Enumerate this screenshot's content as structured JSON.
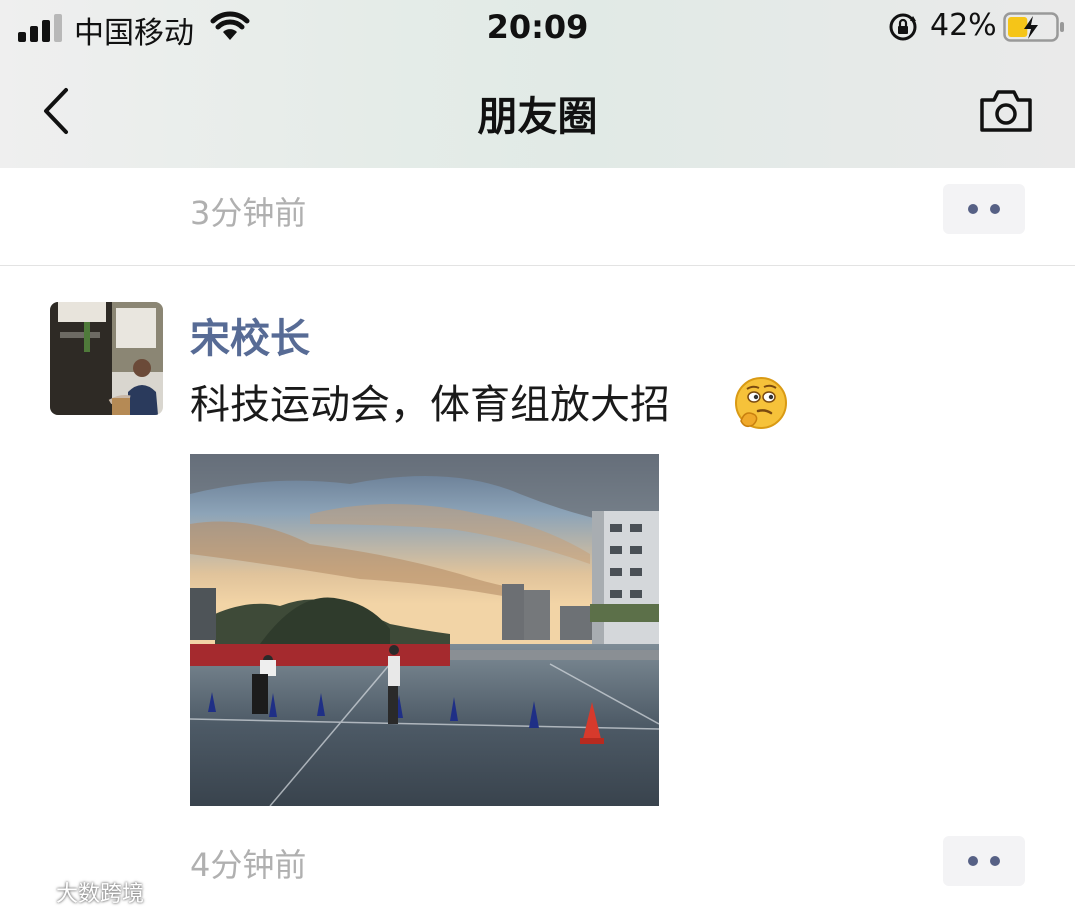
{
  "status_bar": {
    "carrier": "中国移动",
    "time": "20:09",
    "battery_percent": "42%",
    "battery_level": 0.42,
    "icons": [
      "signal-icon",
      "wifi-icon",
      "orientation-lock-icon",
      "battery-charging-icon"
    ]
  },
  "nav": {
    "title": "朋友圈",
    "back_icon": "chevron-left-icon",
    "camera_icon": "camera-icon"
  },
  "feed": {
    "prev_post": {
      "time": "3分钟前"
    },
    "post": {
      "author": "宋校长",
      "text": "科技运动会，体育组放大招",
      "emoji": "thinking-face-emoji",
      "time": "4分钟前"
    }
  },
  "watermark": {
    "text": "大数跨境"
  },
  "colors": {
    "link_blue": "#576b95",
    "time_gray": "#b0b0b0",
    "more_dots": "#566085"
  }
}
